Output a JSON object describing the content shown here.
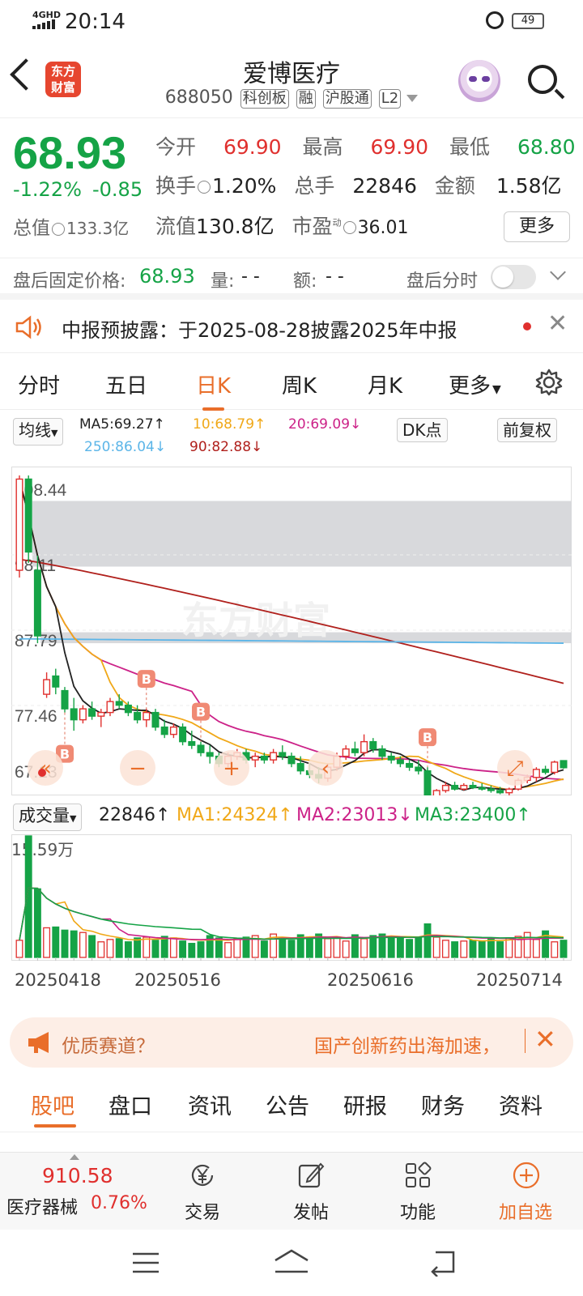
{
  "status": {
    "net": "4GHD",
    "time": "20:14",
    "battery": "49"
  },
  "header": {
    "logo": "东方财富",
    "name": "爱博医疗",
    "code": "688050",
    "tags": [
      "科创板",
      "融",
      "沪股通",
      "L2"
    ]
  },
  "quote": {
    "price": "68.93",
    "change_pct": "-1.22%",
    "change": "-0.85",
    "open_label": "今开",
    "open": "69.90",
    "high_label": "最高",
    "high": "69.90",
    "low_label": "最低",
    "low": "68.80",
    "turnover_label": "换手",
    "turnover": "1.20%",
    "volume_label": "总手",
    "volume": "22846",
    "amount_label": "金额",
    "amount": "1.58亿",
    "mcap_label": "总值",
    "mcap": "133.3亿",
    "float_label": "流值",
    "float_cap": "130.8亿",
    "pe_label": "市盈",
    "pe_sup": "动",
    "pe": "36.01",
    "more": "更多"
  },
  "after_hours": {
    "label": "盘后固定价格:",
    "price": "68.93",
    "vol_label": "量:",
    "vol": "- -",
    "amt_label": "额:",
    "amt": "- -",
    "intraday": "盘后分时"
  },
  "notice": {
    "text": "中报预披露：于2025-08-28披露2025年中报"
  },
  "tabs": [
    "分时",
    "五日",
    "日K",
    "周K",
    "月K",
    "更多"
  ],
  "ma": {
    "type": "均线",
    "ma5": "MA5:69.27↑",
    "ma10": "10:68.79↑",
    "ma20": "20:69.09↓",
    "ma250": "250:86.04↓",
    "ma90": "90:82.88↓",
    "dk": "DK点",
    "adjust": "前复权",
    "colors": {
      "ma5": "#222222",
      "ma10": "#f0a818",
      "ma20": "#cc2288",
      "ma250": "#5bb5e8",
      "ma90": "#b0201c"
    }
  },
  "chart_data": {
    "type": "candlestick",
    "y_ticks": [
      "108.44",
      "98.11",
      "87.79",
      "77.46",
      "67.13"
    ],
    "ylim": [
      67.13,
      108.44
    ],
    "x_labels": [
      "20250418",
      "20250516",
      "20250616",
      "20250714"
    ],
    "candles": [
      [
        96.0,
        109.0,
        95.0,
        108.5
      ],
      [
        108.5,
        109.0,
        97.0,
        98.5
      ],
      [
        96.0,
        98.0,
        86.0,
        87.0
      ],
      [
        79.0,
        82.0,
        78.5,
        81.0
      ],
      [
        81.5,
        82.5,
        79.0,
        80.0
      ],
      [
        79.5,
        80.0,
        76.5,
        77.0
      ],
      [
        77.0,
        78.5,
        74.0,
        75.5
      ],
      [
        75.5,
        77.5,
        75.0,
        77.0
      ],
      [
        77.0,
        78.0,
        75.5,
        76.0
      ],
      [
        76.0,
        77.0,
        74.5,
        76.5
      ],
      [
        76.5,
        78.5,
        76.0,
        78.0
      ],
      [
        78.0,
        79.0,
        77.0,
        77.5
      ],
      [
        77.5,
        78.0,
        76.0,
        76.5
      ],
      [
        76.5,
        77.5,
        75.0,
        75.5
      ],
      [
        75.5,
        77.0,
        74.5,
        76.5
      ],
      [
        76.5,
        77.0,
        74.0,
        74.5
      ],
      [
        74.5,
        75.5,
        73.0,
        73.5
      ],
      [
        73.5,
        75.0,
        73.0,
        74.5
      ],
      [
        74.5,
        75.0,
        72.0,
        72.5
      ],
      [
        72.5,
        74.0,
        71.5,
        72.0
      ],
      [
        72.0,
        72.5,
        70.5,
        71.0
      ],
      [
        71.0,
        72.0,
        69.5,
        70.5
      ],
      [
        70.5,
        71.0,
        69.0,
        69.5
      ],
      [
        69.5,
        71.0,
        69.0,
        70.5
      ],
      [
        70.5,
        71.5,
        70.0,
        71.0
      ],
      [
        71.0,
        71.5,
        69.5,
        70.0
      ],
      [
        70.0,
        71.0,
        69.0,
        70.5
      ],
      [
        70.5,
        71.0,
        69.5,
        70.0
      ],
      [
        70.0,
        71.5,
        69.5,
        71.0
      ],
      [
        71.0,
        72.0,
        70.0,
        70.5
      ],
      [
        70.5,
        71.0,
        69.0,
        69.5
      ],
      [
        69.5,
        70.5,
        68.0,
        68.5
      ],
      [
        68.5,
        69.5,
        67.5,
        68.0
      ],
      [
        68.0,
        69.0,
        66.8,
        67.5
      ],
      [
        67.5,
        69.5,
        67.0,
        69.0
      ],
      [
        69.0,
        71.0,
        68.5,
        70.5
      ],
      [
        70.5,
        72.0,
        70.0,
        71.5
      ],
      [
        71.5,
        72.5,
        70.5,
        71.0
      ],
      [
        71.0,
        73.5,
        70.5,
        72.5
      ],
      [
        72.5,
        73.0,
        71.0,
        71.5
      ],
      [
        71.5,
        72.0,
        70.0,
        70.5
      ],
      [
        70.5,
        71.0,
        69.5,
        70.0
      ],
      [
        70.0,
        70.5,
        69.0,
        69.5
      ],
      [
        69.5,
        70.0,
        68.5,
        69.0
      ],
      [
        69.0,
        70.0,
        68.0,
        68.5
      ],
      [
        68.5,
        69.0,
        64.0,
        64.5
      ],
      [
        64.5,
        66.0,
        64.0,
        65.8
      ],
      [
        65.8,
        67.0,
        65.5,
        66.5
      ],
      [
        66.5,
        67.0,
        65.8,
        66.0
      ],
      [
        66.0,
        66.8,
        65.8,
        66.5
      ],
      [
        66.5,
        67.0,
        66.0,
        66.2
      ],
      [
        66.2,
        66.8,
        65.8,
        66.0
      ],
      [
        66.0,
        66.5,
        65.5,
        65.8
      ],
      [
        65.8,
        66.3,
        65.3,
        65.5
      ],
      [
        65.5,
        66.2,
        65.0,
        66.0
      ],
      [
        66.0,
        67.5,
        65.8,
        67.2
      ],
      [
        67.2,
        68.0,
        66.8,
        67.6
      ],
      [
        67.6,
        69.0,
        67.0,
        68.7
      ],
      [
        68.7,
        69.2,
        68.0,
        68.3
      ],
      [
        68.3,
        69.9,
        68.0,
        69.7
      ],
      [
        69.9,
        69.9,
        68.8,
        68.93
      ]
    ],
    "b_markers": [
      {
        "index": 5,
        "label": "B"
      },
      {
        "index": 14,
        "label": "B"
      },
      {
        "index": 20,
        "label": "B"
      },
      {
        "index": 45,
        "label": "B"
      }
    ]
  },
  "volume": {
    "label": "成交量",
    "value": "22846↑",
    "ma1": "MA1:24324↑",
    "ma2": "MA2:23013↓",
    "ma3": "MA3:23400↑",
    "max_label": "15.59万",
    "values": [
      2.2,
      15.59,
      8.8,
      3.8,
      3.9,
      3.5,
      3.4,
      3.2,
      2.8,
      2.0,
      2.3,
      2.4,
      2.0,
      2.5,
      2.6,
      2.2,
      2.7,
      2.5,
      2.1,
      1.8,
      2.0,
      2.8,
      2.5,
      1.9,
      2.4,
      2.6,
      2.8,
      2.1,
      3.0,
      2.5,
      2.2,
      2.9,
      2.6,
      3.0,
      2.4,
      2.5,
      2.1,
      2.9,
      2.4,
      2.8,
      3.0,
      2.7,
      2.5,
      2.3,
      2.6,
      4.3,
      2.6,
      2.2,
      2.0,
      2.1,
      2.2,
      2.1,
      2.4,
      2.0,
      2.5,
      2.7,
      3.2,
      2.3,
      3.4,
      2.0,
      2.2
    ]
  },
  "banner": {
    "left": "优质赛道？",
    "right": "国产创新药出海加速，"
  },
  "bottom_tabs": [
    "股吧",
    "盘口",
    "资讯",
    "公告",
    "研报",
    "财务",
    "资料"
  ],
  "footer": {
    "index_value": "910.58",
    "index_name": "医疗器械",
    "index_pct": "0.76%",
    "trade": "交易",
    "post": "发帖",
    "func": "功能",
    "watch": "加自选"
  }
}
